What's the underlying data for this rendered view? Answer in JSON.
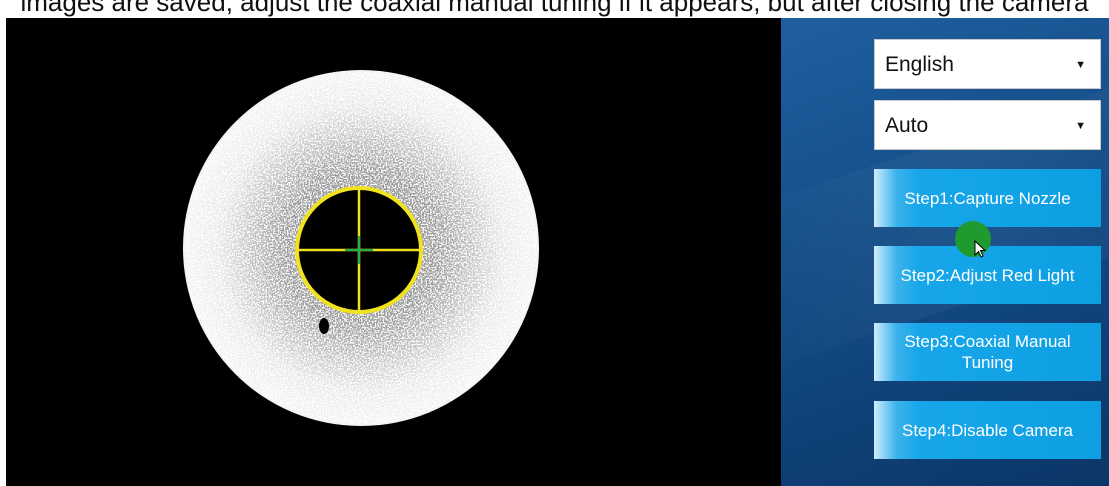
{
  "caption": {
    "text": "images are saved, adjust the coaxial manual tuning if it appears, but after closing the camera"
  },
  "camera_view": {
    "overlay": {
      "ring_color": "#f0e21e",
      "crosshair_color": "#f0e21e",
      "center_mark_color": "#22b14c"
    }
  },
  "controls": {
    "language_select": {
      "value": "English",
      "arrow_icon": "caret-down-icon"
    },
    "mode_select": {
      "value": "Auto",
      "arrow_icon": "caret-down-icon"
    },
    "steps": [
      {
        "label": "Step1:Capture Nozzle"
      },
      {
        "label": "Step2:Adjust Red Light"
      },
      {
        "label": "Step3:Coaxial Manual Tuning"
      },
      {
        "label": "Step4:Disable Camera"
      }
    ],
    "accent_color": "#16a6e9",
    "panel_color": "#16508c"
  }
}
